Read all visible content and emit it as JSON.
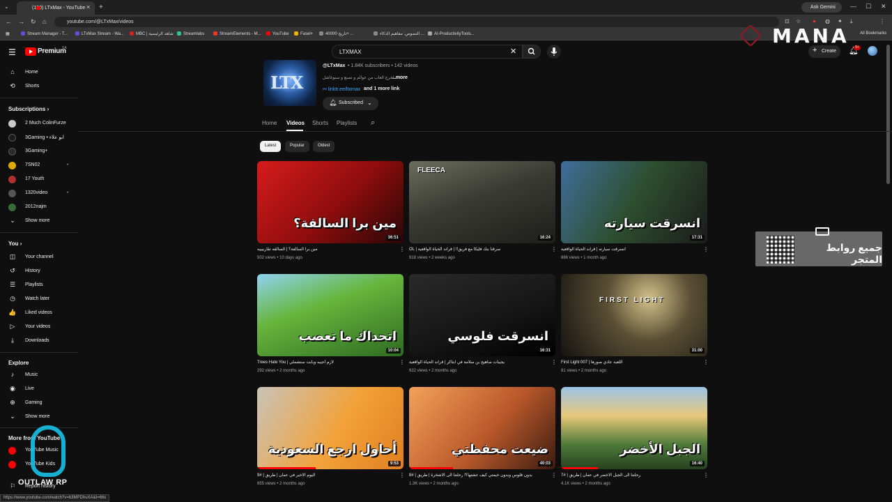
{
  "browser": {
    "tab_title": "(150) LTxMax - YouTube",
    "url": "youtube.com/@LTxMax/videos",
    "ask_gemini": "Ask Gemini",
    "bookmarks": [
      "Stream Manager - T...",
      "LTxMax Stream - Wa...",
      "MBC | شاهد الرئيسية",
      "Streamlabs",
      "StreamElements - M...",
      "YouTube",
      "Fasel+",
      "تاريخ 40000+ ...",
      "النصوص: مفاهيم الذكاء ...",
      "AI-ProductivityTools..."
    ],
    "all_bookmarks": "All Bookmarks",
    "status_url": "https://www.youtube.com/watch?v=b3MPDhuXA&t=66s"
  },
  "youtube": {
    "brand": "Premium",
    "brand_sup": "SA",
    "search_value": "LTXMAX",
    "create_label": "Create",
    "notif_count": "9+"
  },
  "sidebar": {
    "main": [
      {
        "label": "Home",
        "icon": "⌂"
      },
      {
        "label": "Shorts",
        "icon": "⟲"
      }
    ],
    "subscriptions_heading": "Subscriptions",
    "subscriptions": [
      {
        "label": "2 Much ColinFurze",
        "color": "#c9c9c9"
      },
      {
        "label": "3Gaming • ابو علاء",
        "color": "#1c1c1c"
      },
      {
        "label": "3Gaming+",
        "color": "#2a2a2a"
      },
      {
        "label": "7SN02",
        "color": "#e0a800"
      },
      {
        "label": "17 Youth",
        "color": "#b03030"
      },
      {
        "label": "1320video",
        "color": "#555555"
      },
      {
        "label": "2012najm",
        "color": "#3b6b3b"
      }
    ],
    "show_more": "Show more",
    "you_heading": "You",
    "you_items": [
      {
        "label": "Your channel",
        "icon": "◫"
      },
      {
        "label": "History",
        "icon": "↺"
      },
      {
        "label": "Playlists",
        "icon": "☰"
      },
      {
        "label": "Watch later",
        "icon": "◷"
      },
      {
        "label": "Liked videos",
        "icon": "👍"
      },
      {
        "label": "Your videos",
        "icon": "▷"
      },
      {
        "label": "Downloads",
        "icon": "⤓"
      }
    ],
    "explore_heading": "Explore",
    "explore_items": [
      {
        "label": "Music",
        "icon": "♪"
      },
      {
        "label": "Live",
        "icon": "◉"
      },
      {
        "label": "Gaming",
        "icon": "⊕"
      }
    ],
    "show_more_2": "Show more",
    "more_heading": "More from YouTube",
    "more_items": [
      {
        "label": "YouTube Music"
      },
      {
        "label": "YouTube Kids"
      }
    ],
    "report": "Report history"
  },
  "channel": {
    "handle": "@LTxMax",
    "meta": "• 1.84K subscribers • 142 videos",
    "description": "اخرج العاب من عوالم و تصنع و سنوغاشل...",
    "more": "...more",
    "link": "linktr.ee/ltxmax",
    "link_more": "and 1 more link",
    "subscribed": "Subscribed",
    "tabs": [
      "Home",
      "Videos",
      "Shorts",
      "Playlists"
    ],
    "chips": [
      "Latest",
      "Popular",
      "Oldest"
    ]
  },
  "videos": [
    {
      "title": "مين برا السالفة؟ | السالفه تقاربيييه",
      "meta": "502 views • 10 days ago",
      "duration": "36:51",
      "overlay": "مين برا السالفة؟",
      "top": "",
      "bg": "linear-gradient(135deg,#d61b1b 0%,#8d0d0d 55%,#2a0606 100%)",
      "progress": 0
    },
    {
      "title": "OL | سرقنا بنك فليكا مع فريق!! | قراند الحياة الواقعية",
      "meta": "918 views • 2 weeks ago",
      "duration": "16:24",
      "overlay": "",
      "top": "FLEECA",
      "bg": "linear-gradient(160deg,#6b6e5d 0%,#3a3b33 45%,#1d1e1a 100%)",
      "progress": 0
    },
    {
      "title": "انسرقت سيارته | قراند الحياة الواقعية",
      "meta": "866 views • 1 month ago",
      "duration": "17:31",
      "overlay": "انسرقت سيارته",
      "top": "",
      "bg": "linear-gradient(120deg,#3f6e9b 0%,#2d4e2e 50%,#1c1c1c 100%)",
      "progress": 0
    },
    {
      "title": "Trees Hate You | لازم أجيبه وبأبت ستشملي",
      "meta": "292 views • 2 months ago",
      "duration": "10:04",
      "overlay": "اتحداك ما تعصب",
      "top": "",
      "bg": "linear-gradient(160deg,#8fd3f0 0%,#66b53b 40%,#2e6b23 100%)",
      "progress": 0
    },
    {
      "title": "يجيبات ساهيح بن سلامة في ابتاكر | قراند الحياة الواقعية",
      "meta": "922 views • 2 months ago",
      "duration": "16:31",
      "overlay": "انسرقت فلوسي",
      "top": "",
      "bg": "linear-gradient(160deg,#2a2a2a 0%,#141414 60%,#000 100%)",
      "progress": 0
    },
    {
      "title": "First Light 007 | اللعبة عادي صورها",
      "meta": "81 views • 2 months ago",
      "duration": "31:00",
      "overlay": "",
      "top": "FIRST LIGHT",
      "bg": "radial-gradient(circle at 60% 30%,#d4c28a 0%,#5a4f34 40%,#151310 100%)",
      "progress": 0
    },
    {
      "title": "9# | اليوم الاخير في عمان | طريق",
      "meta": "855 views • 2 months ago",
      "duration": "9:53",
      "overlay": "أحاول ارجع السعودية",
      "top": "",
      "bg": "linear-gradient(120deg,#c9c3b8 0%,#f2a23a 55%,#e07f20 100%)",
      "progress": 40
    },
    {
      "title": "8# | بدون فلوس وبدون خيمتي كيف عشتها؟! رحلتنا الى الاشخرة | طريق",
      "meta": "1.3K views • 2 months ago",
      "duration": "40:03",
      "overlay": "ضيعت محفظتي",
      "top": "",
      "bg": "linear-gradient(130deg,#f3a25a 0%,#b9582a 55%,#3d1c10 100%)",
      "progress": 30
    },
    {
      "title": "7# | رحلتنا الى الجبل الاخضر في عمان | طريق",
      "meta": "4.1K views • 2 months ago",
      "duration": "16:40",
      "overlay": "الجبل الأخضر",
      "top": "",
      "bg": "linear-gradient(180deg,#9cc3e6 0%,#e8c87a 35%,#4f7b3a 70%,#26421f 100%)",
      "progress": 25
    }
  ],
  "overlays": {
    "mana": "MANA",
    "store": "جميع روابط المتجر",
    "outlaw": "OUTLAW RP"
  }
}
